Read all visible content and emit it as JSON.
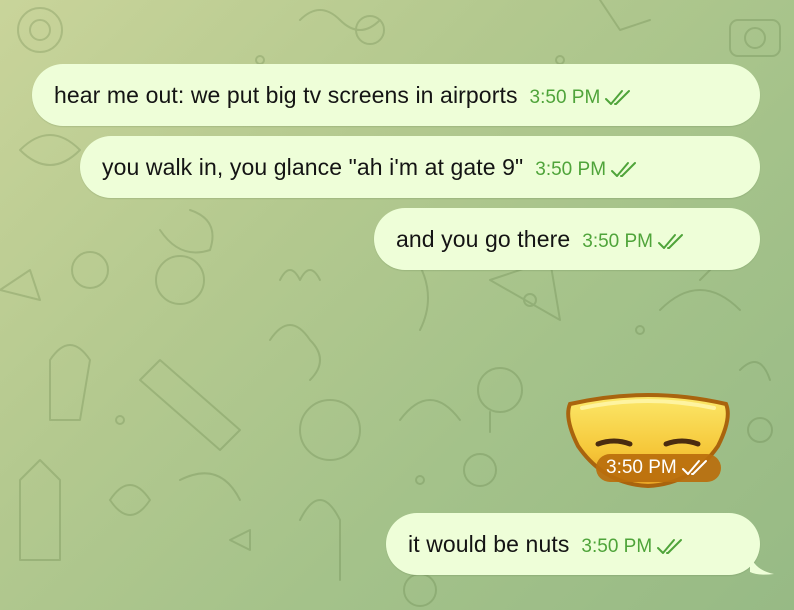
{
  "chat": {
    "messages": [
      {
        "text": "hear me out: we put big tv screens in airports",
        "time": "3:50 PM",
        "status_icon": "double-check-icon"
      },
      {
        "text": "you walk in, you glance \"ah i'm at gate 9\"",
        "time": "3:50 PM",
        "status_icon": "double-check-icon"
      },
      {
        "text": "and you go there",
        "time": "3:50 PM",
        "status_icon": "double-check-icon"
      },
      {
        "sticker": "sleepy-face-sticker",
        "time": "3:50 PM",
        "status_icon": "double-check-icon"
      },
      {
        "text": "it would be nuts",
        "time": "3:50 PM",
        "status_icon": "double-check-icon"
      }
    ]
  },
  "colors": {
    "outgoing_bubble": "#eefed8",
    "timestamp": "#4fa43a",
    "sticker_meta_bg": "#ba6e0c"
  }
}
